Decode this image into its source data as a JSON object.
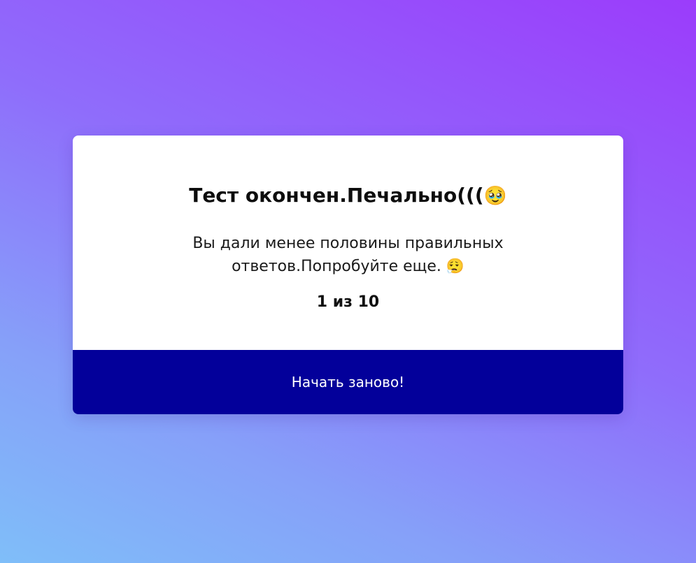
{
  "result": {
    "title": "Тест окончен.Печально(((",
    "title_emoji": "🥹",
    "message": "Вы дали менее половины правильных ответов.Попробуйте еще.",
    "message_emoji": "😮‍💨",
    "score": "1 из 10",
    "restart_label": "Начать заново!"
  },
  "colors": {
    "background_top": "#9b3cfb",
    "background_bottom": "#7fbef9",
    "card": "#ffffff",
    "button": "#03009a",
    "button_text": "#ffffff"
  }
}
